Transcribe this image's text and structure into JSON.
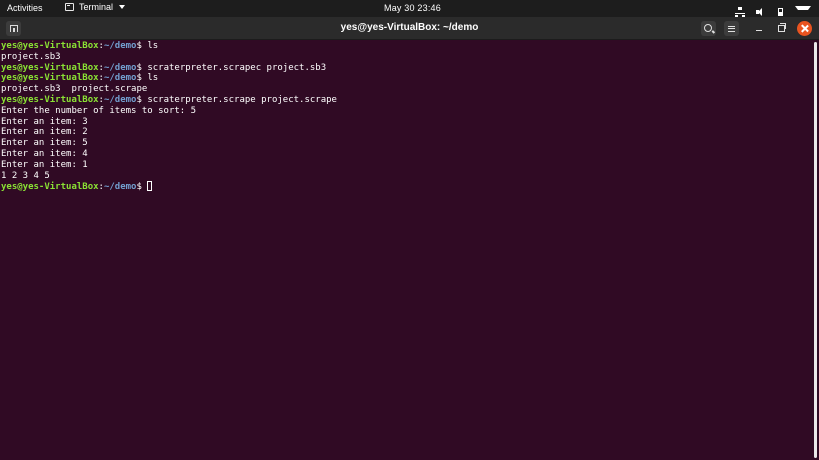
{
  "topbar": {
    "activities": "Activities",
    "app_name": "Terminal",
    "clock": "May 30  23:46",
    "icons": [
      "network-icon",
      "volume-icon",
      "battery-icon",
      "system-menu-chevron-icon"
    ]
  },
  "window": {
    "title": "yes@yes-VirtualBox: ~/demo"
  },
  "prompt": {
    "user_host": "yes@yes-VirtualBox",
    "sep": ":",
    "path": "~/demo",
    "symbol": "$"
  },
  "terminal_lines": [
    {
      "type": "prompt",
      "command": " ls"
    },
    {
      "type": "output",
      "text": "project.sb3"
    },
    {
      "type": "prompt",
      "command": " scraterpreter.scrapec project.sb3"
    },
    {
      "type": "prompt",
      "command": " ls"
    },
    {
      "type": "output",
      "text": "project.sb3  project.scrape"
    },
    {
      "type": "prompt",
      "command": " scraterpreter.scrape project.scrape"
    },
    {
      "type": "output",
      "text": "Enter the number of items to sort: 5"
    },
    {
      "type": "output",
      "text": "Enter an item: 3"
    },
    {
      "type": "output",
      "text": "Enter an item: 2"
    },
    {
      "type": "output",
      "text": "Enter an item: 5"
    },
    {
      "type": "output",
      "text": "Enter an item: 4"
    },
    {
      "type": "output",
      "text": "Enter an item: 1"
    },
    {
      "type": "output",
      "text": "1 2 3 4 5"
    },
    {
      "type": "prompt",
      "command": " ",
      "cursor": true
    }
  ],
  "colors": {
    "background": "#300a24",
    "user_host": "#8ae234",
    "path": "#729fcf",
    "close_button": "#e95420"
  }
}
